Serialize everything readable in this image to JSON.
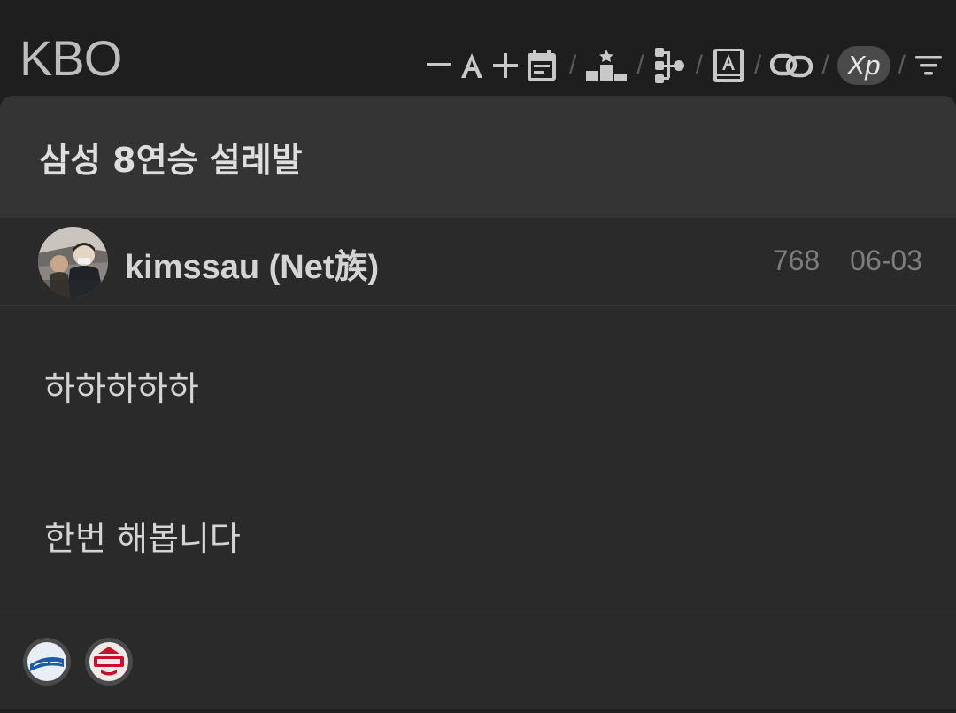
{
  "board": {
    "title": "KBO"
  },
  "toolbar": {
    "items": [
      {
        "icon": "decrease-font-icon"
      },
      {
        "icon": "font-size-icon"
      },
      {
        "icon": "increase-font-icon"
      },
      {
        "icon": "calendar-icon"
      },
      {
        "icon": "ranking-icon"
      },
      {
        "icon": "tree-view-icon"
      },
      {
        "icon": "dictionary-icon"
      },
      {
        "icon": "link-icon"
      },
      {
        "icon": "xp-icon",
        "label": "Xp"
      },
      {
        "icon": "filter-icon"
      }
    ],
    "separator": "/"
  },
  "post": {
    "title": "삼성 8연승 설레발",
    "author": "kimssau (Net族)",
    "views": "768",
    "date": "06-03",
    "body": [
      "하하하하하",
      "한번 해봅니다"
    ]
  },
  "teams": [
    {
      "name": "Samsung Lions",
      "icon": "lions-logo",
      "color": "#1d5aa8"
    },
    {
      "name": "SSG Landers",
      "icon": "landers-logo",
      "color": "#c8102e"
    }
  ],
  "colors": {
    "background": "#1e1e1e",
    "card": "#2a2a2a",
    "header": "#343434",
    "text": "#d4d4d4",
    "muted": "#7d7d7d"
  }
}
